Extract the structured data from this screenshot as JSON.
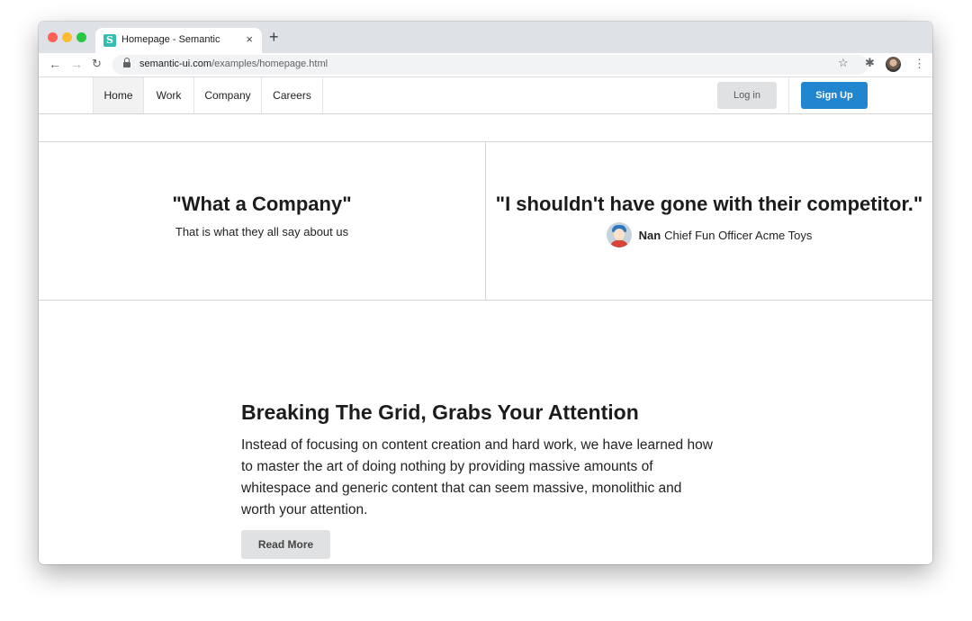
{
  "browser": {
    "tab_title": "Homepage - Semantic",
    "tab_favicon": "S",
    "close_glyph": "×",
    "new_tab_glyph": "+",
    "url_domain": "semantic-ui.com",
    "url_path": "/examples/homepage.html",
    "icons": [
      "back-icon",
      "forward-icon",
      "reload-icon",
      "lock-icon",
      "star-icon",
      "extensions-icon",
      "profile-icon",
      "menu-icon"
    ]
  },
  "nav": {
    "items": [
      "Home",
      "Work",
      "Company",
      "Careers"
    ],
    "active": "Home",
    "login": "Log in",
    "signup": "Sign Up",
    "signup_color": "#2185d0"
  },
  "quotes": {
    "left": {
      "heading": "\"What a Company\"",
      "sub": "That is what they all say about us"
    },
    "right": {
      "heading": "\"I shouldn't have gone with their competitor.\"",
      "author_name": "Nan",
      "author_title": "Chief Fun Officer Acme Toys"
    }
  },
  "feature": {
    "title": "Breaking The Grid, Grabs Your Attention",
    "text": "Instead of focusing on content creation and hard work, we have learned how to master the art of doing nothing by providing massive amounts of whitespace and generic content that can seem massive, monolithic and worth your attention.",
    "button": "Read More"
  }
}
